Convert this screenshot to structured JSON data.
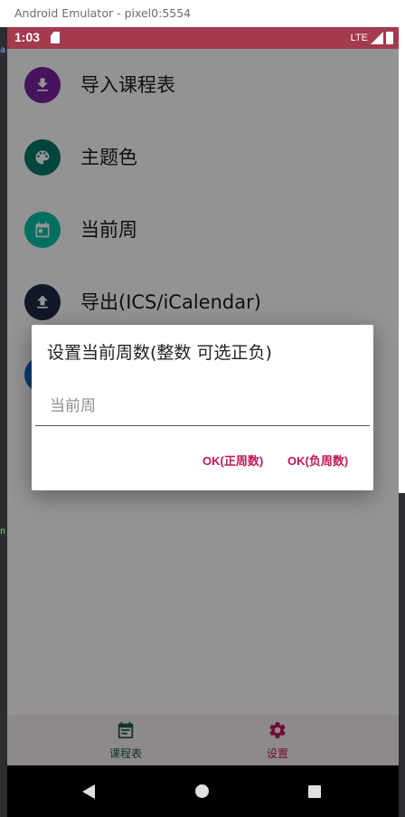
{
  "window": {
    "title": "Android Emulator - pixel0:5554"
  },
  "status_bar": {
    "time": "1:03",
    "network": "LTE"
  },
  "settings": {
    "items": [
      {
        "label": "导入课程表",
        "icon": "download-icon",
        "color": "#7b1fa2"
      },
      {
        "label": "主题色",
        "icon": "palette-icon",
        "color": "#00796b"
      },
      {
        "label": "当前周",
        "icon": "calendar-icon",
        "color": "#00bfa5"
      },
      {
        "label": "导出(ICS/iCalendar)",
        "icon": "upload-icon",
        "color": "#1f2a44"
      },
      {
        "label": "",
        "icon": "info-icon",
        "color": "#1565c0"
      }
    ]
  },
  "bottom_nav": {
    "items": [
      {
        "label": "课程表",
        "icon": "calendar-nav-icon",
        "active": true,
        "color": "#1b5e4a"
      },
      {
        "label": "设置",
        "icon": "gear-icon",
        "active": false,
        "color": "#c2185b"
      }
    ]
  },
  "dialog": {
    "title": "设置当前周数(整数 可选正负)",
    "input_placeholder": "当前周",
    "input_value": "",
    "positive_button": "OK(正周数)",
    "negative_button": "OK(负周数)",
    "accent": "#c2185b"
  },
  "ide_fragments": {
    "left_top": "a",
    "left_mid": "n"
  }
}
